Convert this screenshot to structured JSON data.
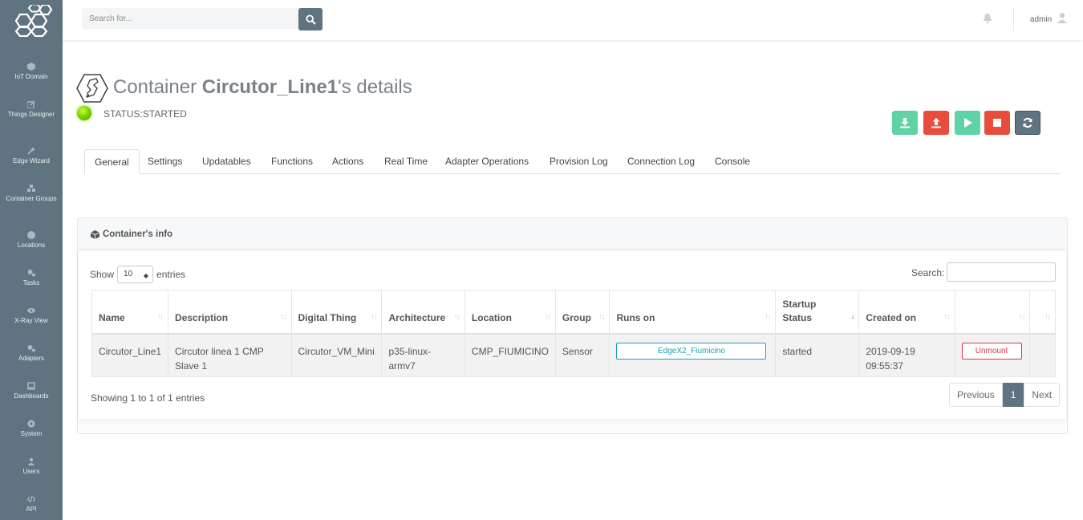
{
  "sidebar": {
    "items": [
      {
        "label": "IoT Domain",
        "icon": "cube-icon"
      },
      {
        "label": "Things Designer",
        "icon": "edit-icon"
      },
      {
        "label": "Edge Wizard",
        "icon": "magic-icon"
      },
      {
        "label": "Container Groups",
        "icon": "cubes-icon"
      },
      {
        "label": "Locations",
        "icon": "globe-icon"
      },
      {
        "label": "Tasks",
        "icon": "cogs-icon"
      },
      {
        "label": "X-Ray View",
        "icon": "eye-icon"
      },
      {
        "label": "Adapters",
        "icon": "cogs-icon"
      },
      {
        "label": "Dashboards",
        "icon": "laptop-icon"
      },
      {
        "label": "System",
        "icon": "gear-icon"
      },
      {
        "label": "Users",
        "icon": "users-icon"
      },
      {
        "label": "API",
        "icon": "code-icon"
      }
    ]
  },
  "topbar": {
    "search_placeholder": "Search for...",
    "user": "admin"
  },
  "header": {
    "title_prefix": "Container ",
    "title_name": "Circutor_Line1",
    "title_suffix": "'s details",
    "status": "STATUS:STARTED",
    "status_color": "#7dd600"
  },
  "actions": [
    {
      "name": "download-button",
      "icon": "download-icon",
      "color": "#5fd3a5"
    },
    {
      "name": "upload-button",
      "icon": "upload-icon",
      "color": "#e74c3c"
    },
    {
      "name": "play-button",
      "icon": "play-icon",
      "color": "#5fd3a5"
    },
    {
      "name": "stop-button",
      "icon": "stop-icon",
      "color": "#e74c3c"
    },
    {
      "name": "refresh-button",
      "icon": "refresh-icon",
      "color": "#5f7480"
    }
  ],
  "tabs": [
    "General",
    "Settings",
    "Updatables",
    "Functions",
    "Actions",
    "Real Time",
    "Adapter Operations",
    "Provision Log",
    "Connection Log",
    "Console"
  ],
  "active_tab": "General",
  "card": {
    "title": "Container's info",
    "show_label": "Show",
    "entries_value": "10",
    "entries_label": "entries",
    "search_label": "Search:",
    "columns": [
      "Name",
      "Description",
      "Digital Thing",
      "Architecture",
      "Location",
      "Group",
      "Runs on",
      "Startup Status",
      "Created on",
      "",
      ""
    ],
    "rows": [
      {
        "name": "Circutor_Line1",
        "description": "Circutor linea 1 CMP Slave 1",
        "digital_thing": "Circutor_VM_Mini",
        "architecture": "p35-linux-armv7",
        "location": "CMP_FIUMICINO",
        "group": "Sensor",
        "runs_on": "EdgeX2_Fiumicino",
        "startup_status": "started",
        "created_on": "2019-09-19 09:55:37",
        "action": "Unmount"
      }
    ],
    "info": "Showing 1 to 1 of 1 entries",
    "pager": {
      "previous": "Previous",
      "current": "1",
      "next": "Next"
    }
  }
}
